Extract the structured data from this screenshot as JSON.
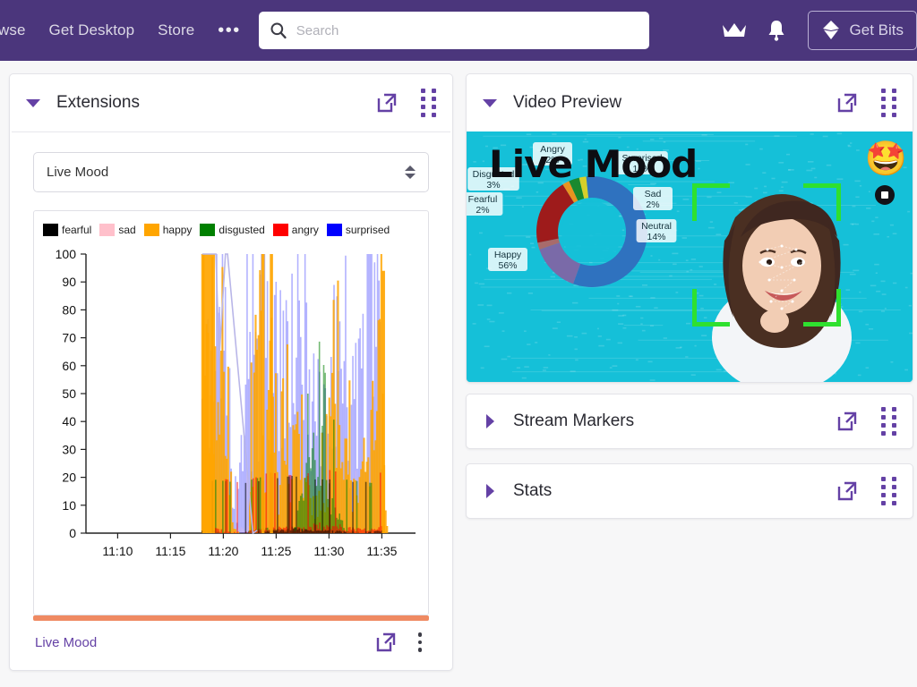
{
  "topnav": {
    "links": [
      {
        "label": "wse",
        "name": "nav-link-browse"
      },
      {
        "label": "Get Desktop",
        "name": "nav-link-get-desktop"
      },
      {
        "label": "Store",
        "name": "nav-link-store"
      }
    ],
    "more_label": "•••",
    "search": {
      "placeholder": "Search",
      "value": ""
    },
    "crown_icon": "crown-icon",
    "bell_icon": "bell-icon",
    "get_bits_label": "Get Bits",
    "bits_icon": "bits-diamond-icon",
    "background_color": "#4b367c"
  },
  "extensions_card": {
    "title": "Extensions",
    "expanded": true,
    "popout_icon": "popout-icon",
    "drag_icon": "drag-handle-icon",
    "select": {
      "value": "Live Mood",
      "options": [
        "Live Mood"
      ]
    },
    "footer": {
      "link_label": "Live Mood",
      "accent_color": "#ef8a62",
      "popout_icon": "popout-icon",
      "menu_icon": "kebab-menu-icon"
    }
  },
  "video_card": {
    "title": "Video Preview",
    "expanded": true,
    "popout_icon": "popout-icon",
    "drag_icon": "drag-handle-icon",
    "stage": {
      "overlay_title": "Live Mood",
      "background_color": "#15c0d8",
      "emoji": "🤩",
      "tracking_box_color": "#2fe02f",
      "record_icon": "stop-record-icon"
    },
    "donut": {
      "type": "pie",
      "title": "",
      "segments": [
        {
          "label": "Happy",
          "value": 56,
          "color": "#2f72bf"
        },
        {
          "label": "Neutral",
          "value": 14,
          "color": "#7a6aa8"
        },
        {
          "label": "Sad",
          "value": 2,
          "color": "#a86b6b"
        },
        {
          "label": "Surprised",
          "value": 19,
          "color": "#9e1b1b"
        },
        {
          "label": "Angry",
          "value": 2,
          "color": "#e8931f"
        },
        {
          "label": "Disgusted",
          "value": 3,
          "color": "#19892f"
        },
        {
          "label": "Fearful",
          "value": 2,
          "color": "#d7cf2a"
        }
      ]
    }
  },
  "markers_card": {
    "title": "Stream Markers",
    "expanded": false,
    "popout_icon": "popout-icon",
    "drag_icon": "drag-handle-icon"
  },
  "stats_card": {
    "title": "Stats",
    "expanded": false,
    "popout_icon": "popout-icon",
    "drag_icon": "drag-handle-icon"
  },
  "chart_data": {
    "type": "line",
    "title": "",
    "xlabel": "",
    "ylabel": "",
    "xlim": [
      "11:07",
      "11:37"
    ],
    "ylim": [
      0,
      100
    ],
    "yticks": [
      0,
      10,
      20,
      30,
      40,
      50,
      60,
      70,
      80,
      90,
      100
    ],
    "xticks": [
      "11:10",
      "11:15",
      "11:20",
      "11:25",
      "11:30",
      "11:35"
    ],
    "grid": false,
    "legend_position": "top-left",
    "series": [
      {
        "name": "fearful",
        "color": "#000000",
        "x": [
          "11:18",
          "11:19",
          "11:20",
          "11:23",
          "11:25",
          "11:27",
          "11:30",
          "11:33",
          "11:35"
        ],
        "values": [
          1,
          0,
          0,
          1,
          2,
          1,
          1,
          0,
          1
        ]
      },
      {
        "name": "sad",
        "color": "#ffc0cb",
        "x": [
          "11:18",
          "11:20",
          "11:23",
          "11:25",
          "11:27",
          "11:30",
          "11:32",
          "11:34",
          "11:35"
        ],
        "values": [
          2,
          0,
          3,
          5,
          4,
          2,
          6,
          3,
          2
        ]
      },
      {
        "name": "happy",
        "color": "#ffa500",
        "x": [
          "11:18",
          "11:18.5",
          "11:19",
          "11:19.5",
          "11:20",
          "11:21",
          "11:22",
          "11:23",
          "11:23.5",
          "11:24",
          "11:24.5",
          "11:25",
          "11:25.5",
          "11:26",
          "11:26.5",
          "11:27",
          "11:28",
          "11:29",
          "11:30",
          "11:31",
          "11:32",
          "11:33",
          "11:34",
          "11:35",
          "11:35.5"
        ],
        "values": [
          100,
          100,
          88,
          90,
          2,
          0,
          0,
          92,
          30,
          100,
          20,
          40,
          35,
          55,
          12,
          20,
          10,
          88,
          40,
          30,
          25,
          35,
          20,
          94,
          5
        ]
      },
      {
        "name": "disgusted",
        "color": "#008000",
        "x": [
          "11:19",
          "11:22",
          "11:25",
          "11:28",
          "11:30",
          "11:32",
          "11:34"
        ],
        "values": [
          1,
          0,
          2,
          1,
          42,
          1,
          0
        ]
      },
      {
        "name": "angry",
        "color": "#ff0000",
        "x": [
          "11:19",
          "11:22",
          "11:25",
          "11:28",
          "11:31",
          "11:33",
          "11:35"
        ],
        "values": [
          2,
          0,
          3,
          2,
          4,
          2,
          3
        ]
      },
      {
        "name": "surprised",
        "color": "#0000ff",
        "x": [
          "11:18",
          "11:19",
          "11:20",
          "11:22",
          "11:23",
          "11:24",
          "11:25",
          "11:26",
          "11:27",
          "11:28",
          "11:29",
          "11:30",
          "11:31",
          "11:32",
          "11:33",
          "11:34",
          "11:35"
        ],
        "values": [
          100,
          100,
          60,
          0,
          70,
          100,
          80,
          95,
          60,
          100,
          65,
          48,
          100,
          55,
          70,
          100,
          90
        ]
      }
    ]
  }
}
